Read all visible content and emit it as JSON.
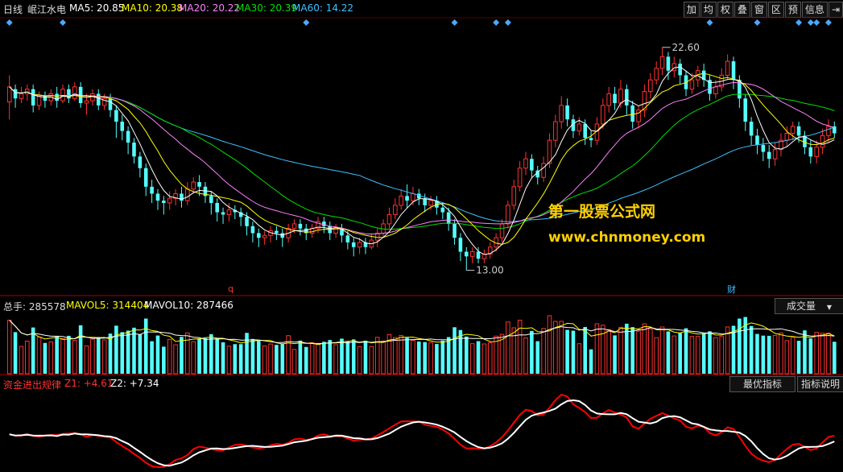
{
  "header": {
    "period": "日线",
    "stock": "岷江水电",
    "ma5": "MA5: 20.85",
    "ma10": "MA10: 20.38",
    "ma20": "MA20: 20.22",
    "ma30": "MA30: 20.39",
    "ma60": "MA60: 14.22"
  },
  "toolbar": [
    "加",
    "均",
    "权",
    "叠",
    "窗",
    "区",
    "预",
    "信息"
  ],
  "price_panel": {
    "high_label": "22.60",
    "low_label": "13.00",
    "marker_q": "q",
    "marker_cai": "财"
  },
  "watermark": {
    "line1": "第一股票公式网",
    "line2": "www.chnmoney.com"
  },
  "volume_panel": {
    "total": "总手: 285578",
    "mavol5": "MAVOL5: 314404",
    "mavol10": "MAVOL10: 287466",
    "button": "成交量"
  },
  "indicator_panel": {
    "name": "资金进出规律",
    "z1": "Z1: +4.61",
    "z2": "Z2: +7.34",
    "btn_best": "最优指标",
    "btn_help": "指标说明"
  },
  "colors": {
    "up": "#ff3232",
    "down": "#54ffff",
    "ma5": "#ffffff",
    "ma10": "#ffff00",
    "ma20": "#ff80ff",
    "ma30": "#00e000",
    "ma60": "#40c0ff",
    "z1": "#ff0000",
    "z2": "#ffffff",
    "diamond": "#4aa8ff"
  },
  "chart_data": {
    "type": "candlestick",
    "title": "岷江水电 日线",
    "price_range": [
      12.5,
      23.6
    ],
    "annotations": [
      {
        "label": "22.60",
        "kind": "high"
      },
      {
        "label": "13.00",
        "kind": "low"
      }
    ],
    "candles": [
      [
        20.25,
        20.9,
        21.4,
        19.5
      ],
      [
        20.8,
        20.4,
        21.0,
        20.0
      ],
      [
        20.4,
        20.6,
        20.9,
        20.2
      ],
      [
        20.6,
        20.8,
        21.0,
        20.3
      ],
      [
        20.8,
        20.1,
        21.0,
        19.8
      ],
      [
        20.1,
        20.5,
        20.7,
        19.9
      ],
      [
        20.5,
        20.3,
        20.7,
        20.0
      ],
      [
        20.3,
        20.6,
        20.8,
        20.1
      ],
      [
        20.6,
        20.3,
        20.9,
        20.0
      ],
      [
        20.3,
        20.8,
        21.0,
        20.2
      ],
      [
        20.8,
        20.4,
        21.0,
        20.2
      ],
      [
        20.4,
        20.9,
        21.1,
        20.3
      ],
      [
        20.9,
        20.2,
        21.1,
        20.0
      ],
      [
        20.2,
        20.3,
        20.6,
        19.7
      ],
      [
        20.3,
        20.6,
        20.8,
        20.1
      ],
      [
        20.6,
        20.1,
        20.8,
        19.9
      ],
      [
        20.1,
        20.4,
        20.6,
        19.9
      ],
      [
        20.4,
        19.9,
        20.6,
        19.6
      ],
      [
        19.9,
        19.4,
        20.1,
        18.7
      ],
      [
        19.4,
        19.0,
        19.7,
        18.6
      ],
      [
        19.0,
        18.5,
        19.2,
        18.0
      ],
      [
        18.5,
        17.9,
        18.7,
        17.6
      ],
      [
        17.9,
        17.4,
        18.1,
        17.0
      ],
      [
        17.4,
        16.6,
        17.6,
        16.2
      ],
      [
        16.6,
        16.3,
        16.9,
        15.9
      ],
      [
        16.3,
        16.0,
        16.5,
        15.6
      ],
      [
        16.0,
        15.9,
        16.2,
        15.4
      ],
      [
        15.9,
        16.1,
        16.4,
        15.6
      ],
      [
        16.1,
        16.3,
        16.5,
        15.8
      ],
      [
        16.3,
        16.0,
        16.6,
        15.7
      ],
      [
        16.0,
        16.5,
        16.8,
        15.8
      ],
      [
        16.5,
        16.8,
        17.0,
        16.3
      ],
      [
        16.8,
        16.6,
        17.1,
        16.2
      ],
      [
        16.6,
        16.2,
        16.8,
        15.9
      ],
      [
        16.2,
        15.9,
        16.4,
        15.4
      ],
      [
        15.9,
        15.5,
        16.1,
        15.1
      ],
      [
        15.5,
        15.4,
        15.7,
        15.0
      ],
      [
        15.4,
        15.6,
        15.9,
        15.1
      ],
      [
        15.6,
        15.5,
        15.8,
        15.2
      ],
      [
        15.5,
        15.3,
        15.7,
        14.9
      ],
      [
        15.3,
        14.9,
        15.5,
        14.5
      ],
      [
        14.9,
        14.6,
        15.1,
        14.2
      ],
      [
        14.6,
        14.4,
        14.8,
        14.0
      ],
      [
        14.4,
        14.5,
        14.7,
        14.1
      ],
      [
        14.5,
        14.7,
        14.9,
        14.2
      ],
      [
        14.7,
        14.6,
        14.9,
        14.3
      ],
      [
        14.6,
        14.4,
        14.8,
        14.0
      ],
      [
        14.4,
        14.8,
        15.0,
        14.2
      ],
      [
        14.8,
        15.0,
        15.2,
        14.6
      ],
      [
        15.0,
        14.8,
        15.2,
        14.5
      ],
      [
        14.8,
        14.6,
        15.0,
        14.3
      ],
      [
        14.6,
        14.8,
        15.0,
        14.4
      ],
      [
        14.8,
        15.1,
        15.3,
        14.6
      ],
      [
        15.1,
        14.9,
        15.3,
        14.6
      ],
      [
        14.9,
        14.6,
        15.1,
        14.3
      ],
      [
        14.6,
        14.8,
        15.0,
        14.4
      ],
      [
        14.8,
        14.5,
        15.0,
        14.2
      ],
      [
        14.5,
        14.2,
        14.7,
        13.9
      ],
      [
        14.2,
        14.0,
        14.4,
        13.6
      ],
      [
        14.0,
        14.2,
        14.4,
        13.7
      ],
      [
        14.2,
        14.0,
        14.4,
        13.7
      ],
      [
        14.0,
        14.3,
        14.6,
        13.9
      ],
      [
        14.3,
        14.6,
        14.8,
        14.0
      ],
      [
        14.6,
        15.0,
        15.2,
        14.4
      ],
      [
        15.0,
        15.4,
        15.7,
        14.8
      ],
      [
        15.4,
        15.8,
        16.1,
        15.2
      ],
      [
        15.8,
        16.2,
        16.5,
        15.6
      ],
      [
        16.2,
        16.0,
        16.7,
        15.7
      ],
      [
        16.0,
        16.3,
        16.6,
        15.8
      ],
      [
        16.3,
        16.1,
        16.5,
        15.8
      ],
      [
        16.1,
        15.8,
        16.3,
        15.5
      ],
      [
        15.8,
        16.0,
        16.2,
        15.6
      ],
      [
        16.0,
        15.7,
        16.2,
        15.4
      ],
      [
        15.7,
        15.5,
        15.9,
        15.2
      ],
      [
        15.5,
        15.0,
        15.7,
        14.7
      ],
      [
        15.0,
        14.4,
        15.2,
        14.1
      ],
      [
        14.4,
        13.8,
        14.6,
        13.4
      ],
      [
        13.8,
        13.6,
        14.0,
        13.0
      ],
      [
        13.6,
        13.8,
        14.0,
        13.3
      ],
      [
        13.8,
        13.5,
        14.0,
        13.3
      ],
      [
        13.5,
        13.7,
        13.9,
        13.3
      ],
      [
        13.7,
        14.0,
        14.2,
        13.5
      ],
      [
        14.0,
        14.4,
        14.6,
        13.8
      ],
      [
        14.4,
        15.0,
        15.2,
        14.2
      ],
      [
        15.0,
        15.8,
        16.0,
        14.8
      ],
      [
        15.8,
        16.6,
        16.9,
        15.6
      ],
      [
        16.6,
        17.4,
        17.7,
        16.4
      ],
      [
        17.4,
        17.8,
        18.1,
        17.1
      ],
      [
        17.8,
        17.3,
        18.0,
        17.0
      ],
      [
        17.3,
        17.0,
        17.5,
        16.7
      ],
      [
        17.0,
        17.6,
        17.9,
        16.8
      ],
      [
        17.6,
        18.6,
        18.9,
        17.4
      ],
      [
        18.6,
        19.4,
        19.7,
        18.3
      ],
      [
        19.4,
        20.1,
        20.5,
        19.1
      ],
      [
        20.1,
        19.5,
        20.4,
        19.2
      ],
      [
        19.5,
        19.0,
        19.7,
        18.7
      ],
      [
        19.0,
        19.3,
        19.6,
        18.8
      ],
      [
        19.3,
        18.7,
        19.5,
        18.4
      ],
      [
        18.7,
        18.6,
        19.0,
        18.3
      ],
      [
        18.6,
        19.3,
        19.6,
        18.4
      ],
      [
        19.3,
        20.1,
        20.4,
        19.1
      ],
      [
        20.1,
        20.6,
        20.9,
        19.8
      ],
      [
        20.6,
        20.2,
        20.9,
        19.9
      ],
      [
        20.2,
        20.8,
        21.2,
        20.0
      ],
      [
        20.8,
        20.1,
        21.0,
        19.7
      ],
      [
        20.1,
        19.4,
        20.3,
        19.1
      ],
      [
        19.4,
        19.9,
        20.1,
        19.1
      ],
      [
        19.9,
        20.7,
        21.0,
        19.6
      ],
      [
        20.7,
        21.2,
        21.5,
        20.4
      ],
      [
        21.2,
        21.7,
        22.0,
        21.0
      ],
      [
        21.7,
        22.2,
        22.6,
        21.4
      ],
      [
        22.2,
        21.6,
        22.4,
        21.2
      ],
      [
        21.6,
        21.9,
        22.2,
        21.3
      ],
      [
        21.9,
        21.4,
        22.1,
        21.0
      ],
      [
        21.4,
        20.8,
        21.6,
        20.5
      ],
      [
        20.8,
        21.2,
        21.5,
        20.6
      ],
      [
        21.2,
        21.6,
        21.8,
        20.9
      ],
      [
        21.6,
        21.2,
        21.9,
        20.9
      ],
      [
        21.2,
        20.6,
        21.4,
        20.3
      ],
      [
        20.6,
        20.9,
        21.2,
        20.4
      ],
      [
        20.9,
        21.4,
        21.7,
        20.7
      ],
      [
        21.4,
        22.0,
        22.3,
        21.2
      ],
      [
        22.0,
        21.2,
        22.2,
        20.8
      ],
      [
        21.2,
        20.4,
        21.4,
        20.0
      ],
      [
        20.4,
        19.4,
        20.6,
        19.0
      ],
      [
        19.4,
        18.8,
        19.6,
        18.4
      ],
      [
        18.8,
        18.4,
        19.1,
        18.0
      ],
      [
        18.4,
        18.1,
        18.7,
        17.7
      ],
      [
        18.1,
        17.8,
        18.4,
        17.4
      ],
      [
        17.8,
        18.2,
        18.5,
        17.5
      ],
      [
        18.2,
        18.6,
        18.9,
        17.9
      ],
      [
        18.6,
        18.9,
        19.2,
        18.3
      ],
      [
        18.9,
        19.2,
        19.4,
        18.6
      ],
      [
        19.2,
        18.8,
        19.4,
        18.5
      ],
      [
        18.8,
        18.3,
        19.0,
        18.0
      ],
      [
        18.3,
        17.9,
        18.6,
        17.6
      ],
      [
        17.9,
        18.3,
        18.6,
        17.6
      ],
      [
        18.3,
        18.8,
        19.1,
        18.0
      ],
      [
        18.8,
        19.2,
        19.5,
        18.5
      ],
      [
        19.2,
        18.9,
        19.4,
        18.7
      ]
    ]
  }
}
